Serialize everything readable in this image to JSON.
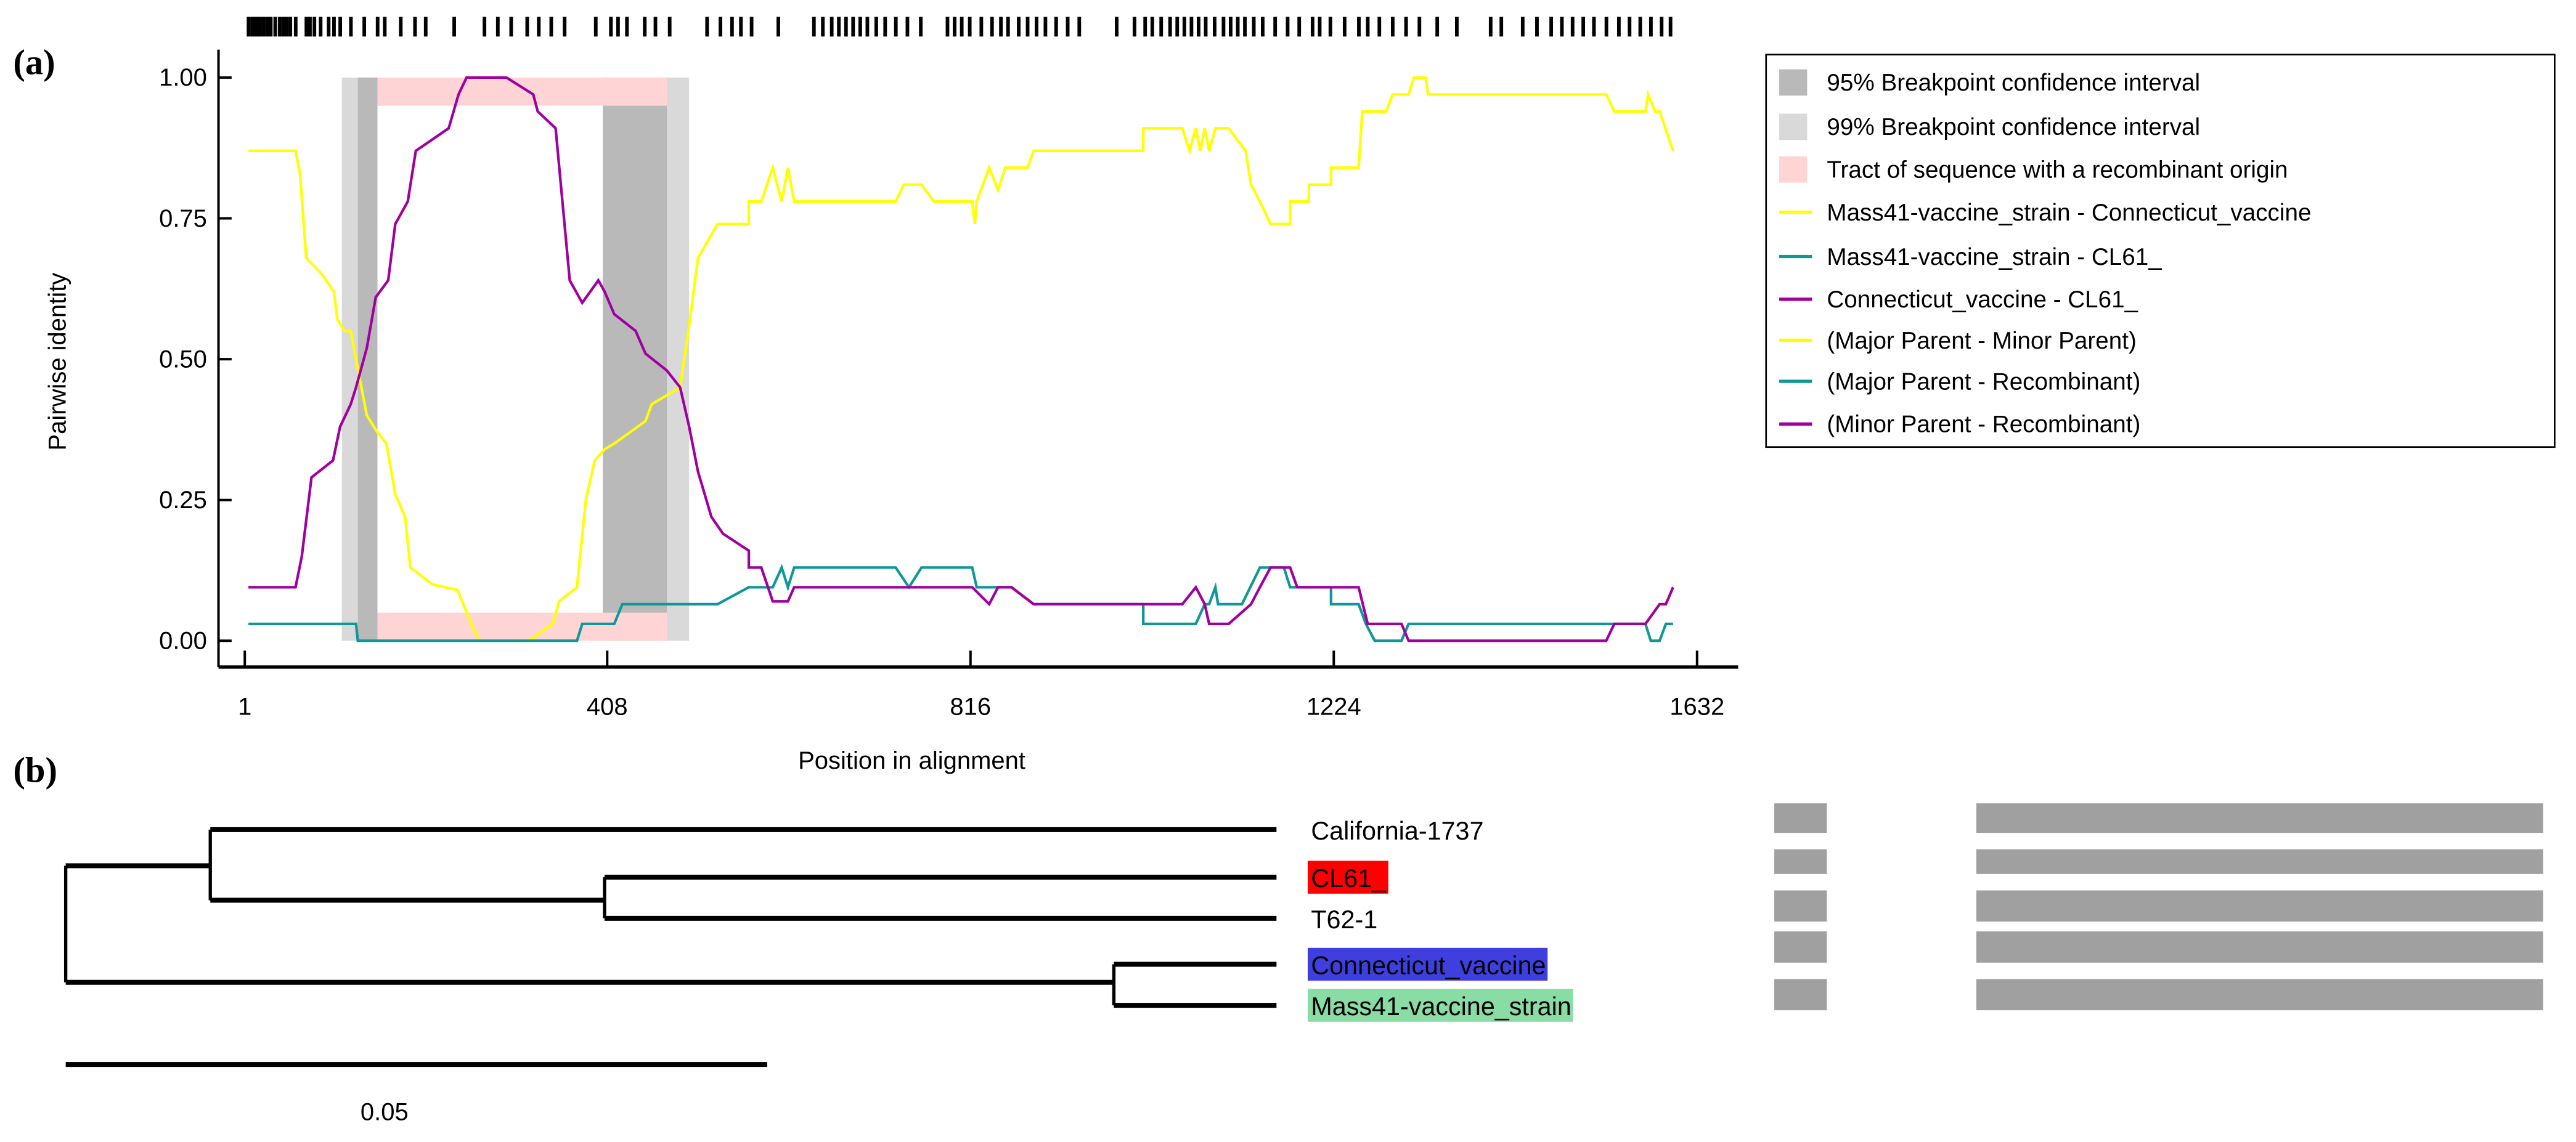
{
  "panel_a_label": "(a)",
  "panel_b_label": "(b)",
  "chart_data": {
    "type": "line",
    "title": "",
    "xlabel": "Position in alignment",
    "ylabel": "Pairwise identity",
    "xlim": [
      1,
      1632
    ],
    "ylim": [
      0,
      1
    ],
    "xticks": [
      "1",
      "408",
      "816",
      "1224",
      "1632"
    ],
    "xtick_values": [
      1,
      408,
      816,
      1224,
      1632
    ],
    "yticks": [
      "0.00",
      "0.25",
      "0.50",
      "0.75",
      "1.00"
    ],
    "ytick_values": [
      0,
      0.25,
      0.5,
      0.75,
      1
    ],
    "grid": false,
    "legend_position": "right",
    "ci95": [
      [
        128,
        150
      ],
      [
        403,
        475
      ]
    ],
    "ci99": [
      [
        110,
        150
      ],
      [
        403,
        500
      ]
    ],
    "recombinant_tract": [
      150,
      475
    ],
    "informative_sites": [
      5,
      9,
      12,
      15,
      18,
      22,
      26,
      30,
      35,
      40,
      44,
      48,
      52,
      58,
      70,
      74,
      79,
      86,
      95,
      101,
      108,
      120,
      135,
      150,
      158,
      176,
      192,
      204,
      236,
      270,
      285,
      300,
      318,
      331,
      345,
      360,
      395,
      412,
      420,
      430,
      450,
      462,
      478,
      520,
      535,
      548,
      558,
      570,
      600,
      640,
      650,
      660,
      668,
      676,
      684,
      692,
      700,
      710,
      720,
      732,
      745,
      760,
      790,
      798,
      806,
      815,
      828,
      840,
      850,
      858,
      870,
      880,
      890,
      900,
      912,
      925,
      938,
      980,
      1000,
      1012,
      1020,
      1030,
      1040,
      1048,
      1056,
      1064,
      1072,
      1080,
      1090,
      1100,
      1108,
      1116,
      1124,
      1134,
      1144,
      1158,
      1172,
      1185,
      1200,
      1208,
      1220,
      1236,
      1252,
      1262,
      1275,
      1290,
      1305,
      1320,
      1340,
      1362,
      1400,
      1412,
      1436,
      1452,
      1468,
      1480,
      1492,
      1504,
      1516,
      1530,
      1544,
      1556,
      1568,
      1580,
      1592,
      1602
    ],
    "legend": [
      {
        "label": "95% Breakpoint confidence interval",
        "kind": "box",
        "color": "#b9b9b9"
      },
      {
        "label": "99% Breakpoint confidence interval",
        "kind": "box",
        "color": "#d9d9d9"
      },
      {
        "label": "Tract of sequence with a recombinant origin",
        "kind": "box",
        "color": "#ffd4d4"
      },
      {
        "label": "Mass41-vaccine_strain - Connecticut_vaccine",
        "kind": "line",
        "color": "#ffff00"
      },
      {
        "label": "Mass41-vaccine_strain - CL61_",
        "kind": "line",
        "color": "#109898"
      },
      {
        "label": "Connecticut_vaccine - CL61_",
        "kind": "line",
        "color": "#a000a0"
      },
      {
        "label": "(Major Parent - Minor Parent)",
        "kind": "line",
        "color": "#ffff00"
      },
      {
        "label": "(Major Parent - Recombinant)",
        "kind": "line",
        "color": "#109898"
      },
      {
        "label": "(Minor Parent - Recombinant)",
        "kind": "line",
        "color": "#a000a0"
      }
    ],
    "series": [
      {
        "name": "Mass41-vaccine_strain - Connecticut_vaccine",
        "color": "#ffff00",
        "points": [
          [
            5,
            0.87
          ],
          [
            58,
            0.87
          ],
          [
            63,
            0.83
          ],
          [
            70,
            0.68
          ],
          [
            88,
            0.65
          ],
          [
            101,
            0.62
          ],
          [
            105,
            0.57
          ],
          [
            113,
            0.55
          ],
          [
            120,
            0.55
          ],
          [
            126,
            0.5
          ],
          [
            138,
            0.4
          ],
          [
            150,
            0.37
          ],
          [
            160,
            0.35
          ],
          [
            170,
            0.26
          ],
          [
            181,
            0.22
          ],
          [
            187,
            0.13
          ],
          [
            212,
            0.1
          ],
          [
            240,
            0.09
          ],
          [
            258,
            0.02
          ],
          [
            265,
            0
          ],
          [
            320,
            0
          ],
          [
            347,
            0.03
          ],
          [
            354,
            0.07
          ],
          [
            374,
            0.095
          ],
          [
            384,
            0.25
          ],
          [
            394,
            0.32
          ],
          [
            405,
            0.34
          ],
          [
            416,
            0.35
          ],
          [
            451,
            0.39
          ],
          [
            458,
            0.42
          ],
          [
            490,
            0.45
          ],
          [
            500,
            0.56
          ],
          [
            510,
            0.68
          ],
          [
            532,
            0.74
          ],
          [
            567,
            0.74
          ],
          [
            567,
            0.78
          ],
          [
            581,
            0.78
          ],
          [
            594,
            0.84
          ],
          [
            604,
            0.78
          ],
          [
            611,
            0.84
          ],
          [
            618,
            0.78
          ],
          [
            732,
            0.78
          ],
          [
            741,
            0.81
          ],
          [
            761,
            0.81
          ],
          [
            775,
            0.78
          ],
          [
            818,
            0.78
          ],
          [
            821,
            0.74
          ],
          [
            823,
            0.78
          ],
          [
            837,
            0.84
          ],
          [
            847,
            0.8
          ],
          [
            855,
            0.84
          ],
          [
            880,
            0.84
          ],
          [
            887,
            0.87
          ],
          [
            1010,
            0.87
          ],
          [
            1010,
            0.91
          ],
          [
            1054,
            0.91
          ],
          [
            1062,
            0.87
          ],
          [
            1069,
            0.91
          ],
          [
            1074,
            0.87
          ],
          [
            1079,
            0.91
          ],
          [
            1084,
            0.87
          ],
          [
            1091,
            0.91
          ],
          [
            1106,
            0.91
          ],
          [
            1125,
            0.87
          ],
          [
            1131,
            0.81
          ],
          [
            1141,
            0.78
          ],
          [
            1153,
            0.74
          ],
          [
            1175,
            0.74
          ],
          [
            1175,
            0.78
          ],
          [
            1196,
            0.78
          ],
          [
            1196,
            0.81
          ],
          [
            1221,
            0.81
          ],
          [
            1221,
            0.84
          ],
          [
            1252,
            0.84
          ],
          [
            1256,
            0.94
          ],
          [
            1283,
            0.94
          ],
          [
            1290,
            0.97
          ],
          [
            1308,
            0.97
          ],
          [
            1314,
            1
          ],
          [
            1327,
            1
          ],
          [
            1330,
            0.97
          ],
          [
            1530,
            0.97
          ],
          [
            1539,
            0.94
          ],
          [
            1574,
            0.94
          ],
          [
            1577,
            0.97
          ],
          [
            1585,
            0.94
          ],
          [
            1590,
            0.94
          ],
          [
            1605,
            0.87
          ]
        ]
      },
      {
        "name": "Mass41-vaccine_strain - CL61_",
        "color": "#109898",
        "points": [
          [
            5,
            0.03
          ],
          [
            126,
            0.03
          ],
          [
            128,
            0
          ],
          [
            374,
            0
          ],
          [
            380,
            0.03
          ],
          [
            416,
            0.03
          ],
          [
            425,
            0.065
          ],
          [
            532,
            0.065
          ],
          [
            567,
            0.095
          ],
          [
            594,
            0.095
          ],
          [
            604,
            0.13
          ],
          [
            611,
            0.095
          ],
          [
            618,
            0.13
          ],
          [
            732,
            0.13
          ],
          [
            747,
            0.095
          ],
          [
            761,
            0.13
          ],
          [
            818,
            0.13
          ],
          [
            823,
            0.095
          ],
          [
            862,
            0.095
          ],
          [
            887,
            0.065
          ],
          [
            1010,
            0.065
          ],
          [
            1010,
            0.03
          ],
          [
            1069,
            0.03
          ],
          [
            1079,
            0.065
          ],
          [
            1084,
            0.065
          ],
          [
            1091,
            0.095
          ],
          [
            1094,
            0.065
          ],
          [
            1121,
            0.065
          ],
          [
            1141,
            0.13
          ],
          [
            1168,
            0.13
          ],
          [
            1175,
            0.095
          ],
          [
            1221,
            0.095
          ],
          [
            1221,
            0.065
          ],
          [
            1252,
            0.065
          ],
          [
            1260,
            0.03
          ],
          [
            1270,
            0
          ],
          [
            1300,
            0
          ],
          [
            1308,
            0.03
          ],
          [
            1574,
            0.03
          ],
          [
            1580,
            0
          ],
          [
            1590,
            0
          ],
          [
            1597,
            0.03
          ],
          [
            1605,
            0.03
          ]
        ]
      },
      {
        "name": "Connecticut_vaccine - CL61_",
        "color": "#a000a0",
        "points": [
          [
            5,
            0.095
          ],
          [
            58,
            0.095
          ],
          [
            65,
            0.15
          ],
          [
            76,
            0.29
          ],
          [
            100,
            0.32
          ],
          [
            108,
            0.38
          ],
          [
            120,
            0.42
          ],
          [
            126,
            0.45
          ],
          [
            138,
            0.52
          ],
          [
            148,
            0.61
          ],
          [
            162,
            0.64
          ],
          [
            170,
            0.74
          ],
          [
            184,
            0.78
          ],
          [
            193,
            0.87
          ],
          [
            230,
            0.91
          ],
          [
            241,
            0.97
          ],
          [
            250,
            1
          ],
          [
            295,
            1
          ],
          [
            325,
            0.97
          ],
          [
            330,
            0.94
          ],
          [
            350,
            0.91
          ],
          [
            366,
            0.64
          ],
          [
            380,
            0.6
          ],
          [
            398,
            0.64
          ],
          [
            405,
            0.62
          ],
          [
            416,
            0.58
          ],
          [
            440,
            0.55
          ],
          [
            451,
            0.51
          ],
          [
            475,
            0.48
          ],
          [
            490,
            0.45
          ],
          [
            500,
            0.38
          ],
          [
            510,
            0.3
          ],
          [
            525,
            0.22
          ],
          [
            538,
            0.19
          ],
          [
            567,
            0.16
          ],
          [
            567,
            0.13
          ],
          [
            581,
            0.13
          ],
          [
            594,
            0.07
          ],
          [
            611,
            0.07
          ],
          [
            618,
            0.095
          ],
          [
            818,
            0.095
          ],
          [
            837,
            0.065
          ],
          [
            847,
            0.095
          ],
          [
            862,
            0.095
          ],
          [
            887,
            0.065
          ],
          [
            1054,
            0.065
          ],
          [
            1069,
            0.095
          ],
          [
            1079,
            0.065
          ],
          [
            1084,
            0.03
          ],
          [
            1106,
            0.03
          ],
          [
            1131,
            0.065
          ],
          [
            1141,
            0.095
          ],
          [
            1153,
            0.13
          ],
          [
            1175,
            0.13
          ],
          [
            1183,
            0.095
          ],
          [
            1252,
            0.095
          ],
          [
            1262,
            0.03
          ],
          [
            1300,
            0.03
          ],
          [
            1308,
            0
          ],
          [
            1530,
            0
          ],
          [
            1539,
            0.03
          ],
          [
            1574,
            0.03
          ],
          [
            1590,
            0.065
          ],
          [
            1597,
            0.065
          ],
          [
            1605,
            0.095
          ]
        ]
      }
    ]
  },
  "tree": {
    "scale_label": "0.05",
    "scale_value": 0.05,
    "branches": {
      "root_to_A": 0.0103,
      "A_to_California": 0.076,
      "A_to_B": 0.028,
      "B_to_CL61": 0.048,
      "B_to_T62": 0.048,
      "root_to_C": 0.0747,
      "C_to_Connecticut": 0.0116,
      "C_to_Mass41": 0.0116
    },
    "leaves": [
      {
        "label": "California-1737",
        "highlight": ""
      },
      {
        "label": "CL61_",
        "highlight": "#ff0000"
      },
      {
        "label": "T62-1",
        "highlight": ""
      },
      {
        "label": "Connecticut_vaccine",
        "highlight": "#3f3fdf"
      },
      {
        "label": "Mass41-vaccine_strain",
        "highlight": "#88dca4"
      }
    ],
    "bar_color": "#a0a0a0"
  }
}
